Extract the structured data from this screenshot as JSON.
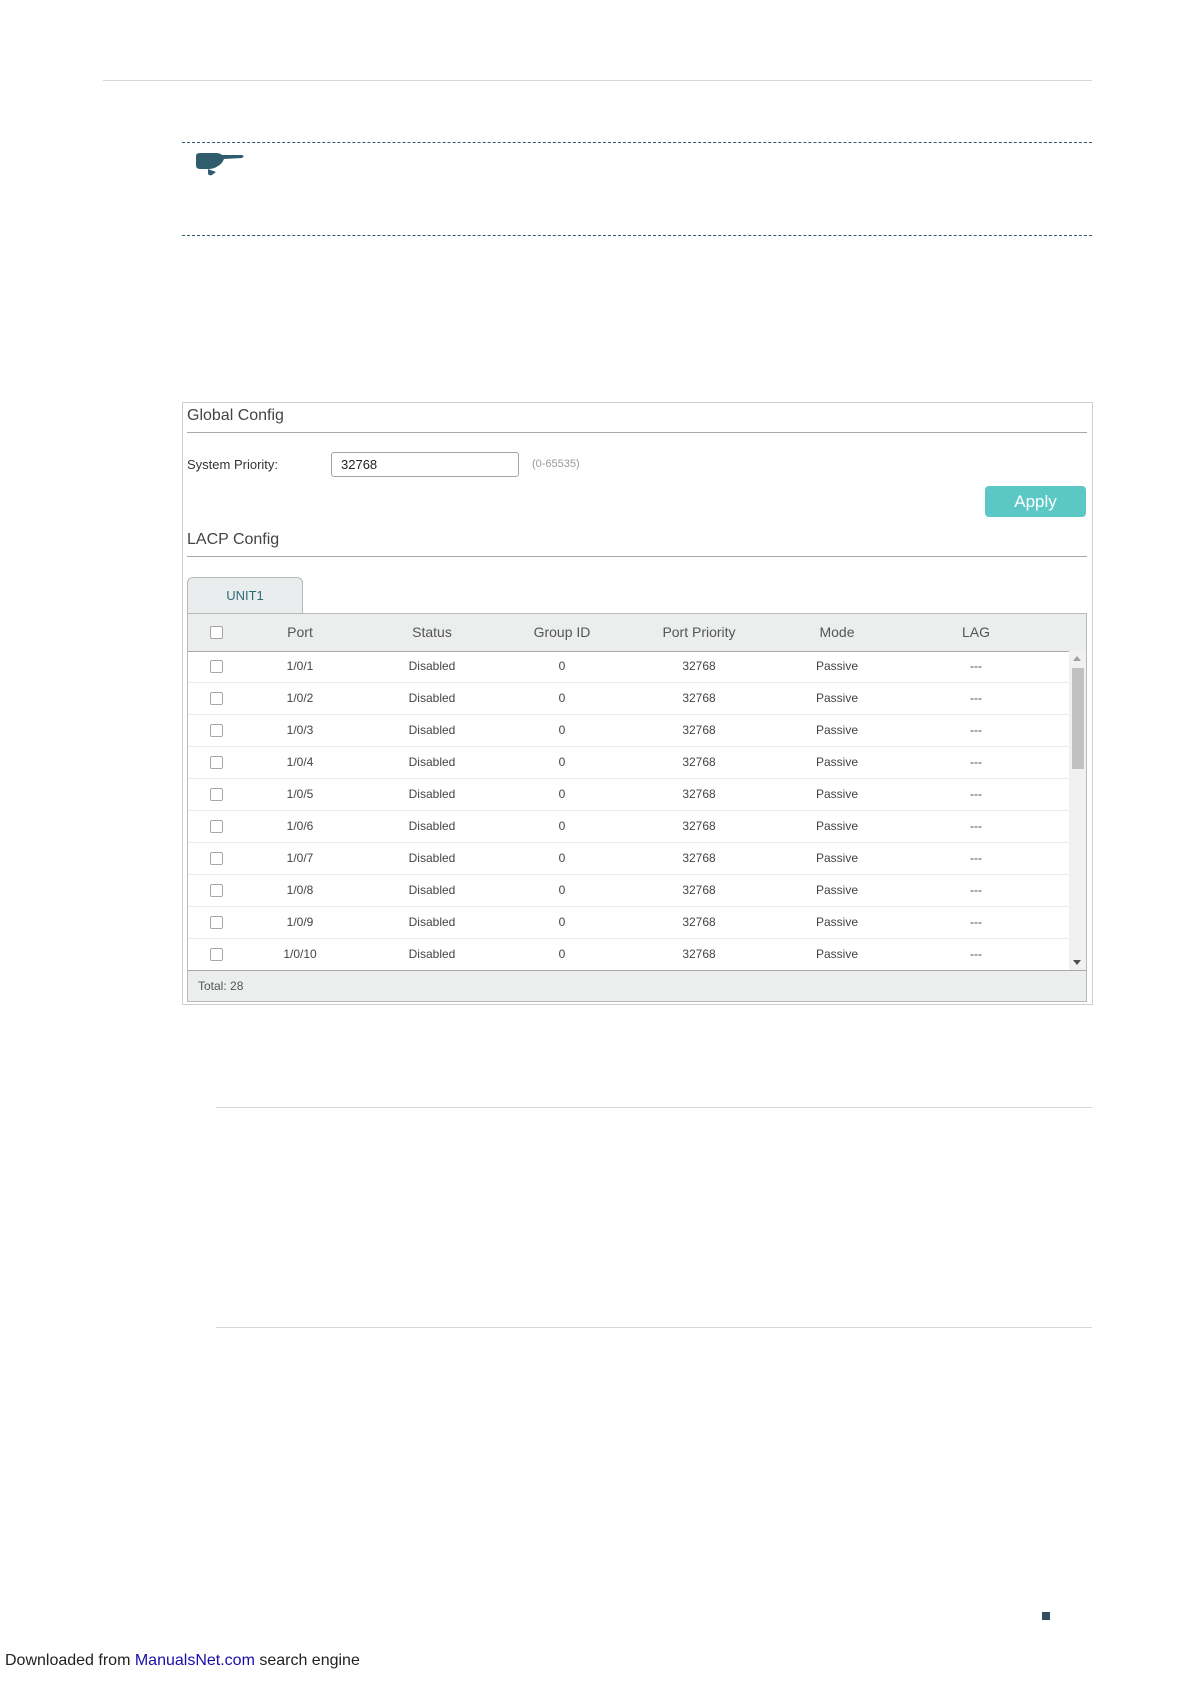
{
  "footer": {
    "prefix": "Downloaded from ",
    "link": "ManualsNet.com",
    "suffix": " search engine"
  },
  "global_config": {
    "title": "Global Config",
    "system_priority_label": "System Priority:",
    "system_priority_value": "32768",
    "system_priority_hint": "(0-65535)",
    "apply_label": "Apply"
  },
  "lacp_config": {
    "title": "LACP Config",
    "tab_label": "UNIT1",
    "columns": [
      "Port",
      "Status",
      "Group ID",
      "Port Priority",
      "Mode",
      "LAG"
    ],
    "rows": [
      {
        "port": "1/0/1",
        "status": "Disabled",
        "group_id": "0",
        "port_priority": "32768",
        "mode": "Passive",
        "lag": "---"
      },
      {
        "port": "1/0/2",
        "status": "Disabled",
        "group_id": "0",
        "port_priority": "32768",
        "mode": "Passive",
        "lag": "---"
      },
      {
        "port": "1/0/3",
        "status": "Disabled",
        "group_id": "0",
        "port_priority": "32768",
        "mode": "Passive",
        "lag": "---"
      },
      {
        "port": "1/0/4",
        "status": "Disabled",
        "group_id": "0",
        "port_priority": "32768",
        "mode": "Passive",
        "lag": "---"
      },
      {
        "port": "1/0/5",
        "status": "Disabled",
        "group_id": "0",
        "port_priority": "32768",
        "mode": "Passive",
        "lag": "---"
      },
      {
        "port": "1/0/6",
        "status": "Disabled",
        "group_id": "0",
        "port_priority": "32768",
        "mode": "Passive",
        "lag": "---"
      },
      {
        "port": "1/0/7",
        "status": "Disabled",
        "group_id": "0",
        "port_priority": "32768",
        "mode": "Passive",
        "lag": "---"
      },
      {
        "port": "1/0/8",
        "status": "Disabled",
        "group_id": "0",
        "port_priority": "32768",
        "mode": "Passive",
        "lag": "---"
      },
      {
        "port": "1/0/9",
        "status": "Disabled",
        "group_id": "0",
        "port_priority": "32768",
        "mode": "Passive",
        "lag": "---"
      },
      {
        "port": "1/0/10",
        "status": "Disabled",
        "group_id": "0",
        "port_priority": "32768",
        "mode": "Passive",
        "lag": "---"
      }
    ],
    "total_label": "Total: 28"
  },
  "colors": {
    "accent": "#5cc8c6",
    "tab_text": "#2e6a78",
    "header_bg": "#eceeee"
  },
  "icons": {
    "note": "pointing-hand-icon"
  }
}
